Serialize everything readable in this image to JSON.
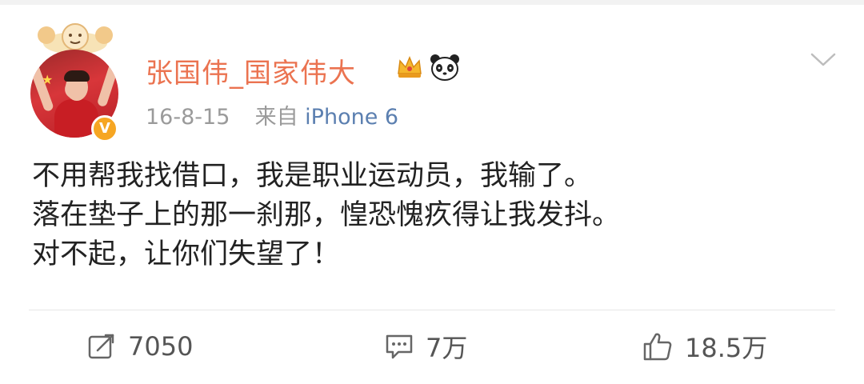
{
  "post": {
    "username": "张国伟_国家伟大",
    "date": "16-8-15",
    "source_prefix": "来自",
    "device": "iPhone 6",
    "verified_badge": "V",
    "content_lines": [
      "不用帮我找借口，我是职业运动员，我输了。",
      "落在垫子上的那一刹那，惶恐愧疚得让我发抖。",
      "对不起，让你们失望了！"
    ]
  },
  "actions": {
    "repost_count": "7050",
    "comment_count": "7万",
    "like_count": "18.5万"
  },
  "icons": {
    "menu": "chevron-down-icon",
    "repost": "repost-icon",
    "comment": "comment-icon",
    "like": "thumbs-up-icon",
    "crown": "crown-icon",
    "panda": "panda-icon"
  },
  "colors": {
    "username": "#eb7350",
    "device": "#5b7fb0",
    "badge": "#f6a623"
  }
}
